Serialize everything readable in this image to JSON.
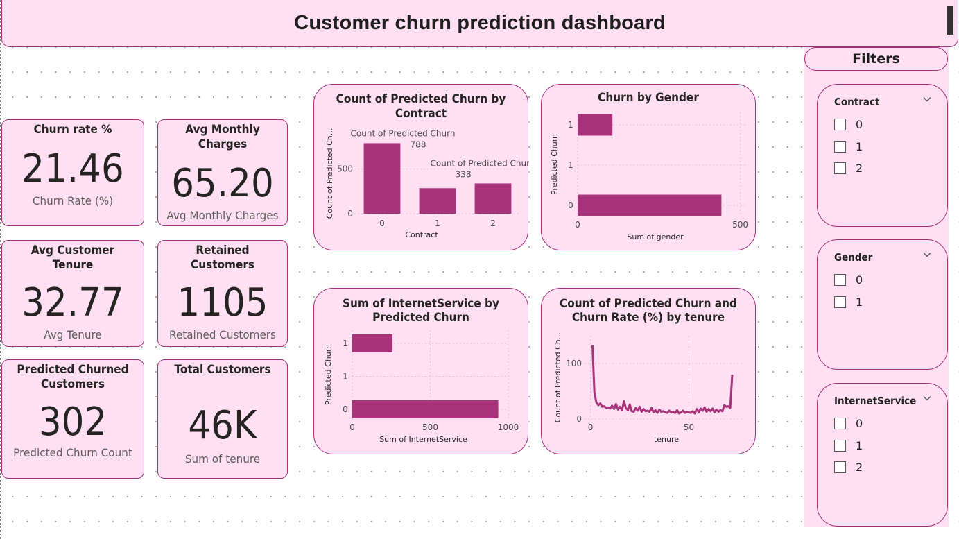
{
  "header": {
    "title": "Customer churn prediction dashboard"
  },
  "kpis": {
    "churn_rate": {
      "title": "Churn rate %",
      "value": "21.46",
      "subtitle": "Churn Rate (%)"
    },
    "avg_monthly": {
      "title": "Avg Monthly Charges",
      "value": "65.20",
      "subtitle": "Avg Monthly Charges"
    },
    "avg_tenure": {
      "title": "Avg Customer Tenure",
      "value": "32.77",
      "subtitle": "Avg Tenure"
    },
    "retained": {
      "title": "Retained Customers",
      "value": "1105",
      "subtitle": "Retained Customers"
    },
    "predicted_churned": {
      "title_line1": "Predicted Churned",
      "title_line2": "Customers",
      "value": "302",
      "subtitle": "Predicted Churn Count"
    },
    "total": {
      "title": "Total Customers",
      "value": "46K",
      "subtitle": "Sum of tenure"
    }
  },
  "chart_titles": {
    "contract": [
      "Count of Predicted Churn by",
      "Contract"
    ],
    "gender": [
      "Churn by Gender"
    ],
    "internet": [
      "Sum of InternetService by",
      "Predicted Churn"
    ],
    "tenure": [
      "Count of Predicted Churn and",
      "Churn Rate (%) by tenure"
    ]
  },
  "chart_data": [
    {
      "id": "contract",
      "type": "bar",
      "xlabel": "Contract",
      "ylabel": "Count of Predicted Ch...",
      "categories": [
        "0",
        "1",
        "2"
      ],
      "values": [
        788,
        285,
        338
      ],
      "ylim": [
        0,
        900
      ],
      "yticks": [
        0,
        500
      ],
      "data_labels": [
        {
          "index": 0,
          "name": "Count of Predicted Churn",
          "value": "788"
        },
        {
          "index": 2,
          "name": "Count of Predicted Churn",
          "value": "338"
        }
      ],
      "color": "#a8337a",
      "grid": true
    },
    {
      "id": "gender",
      "type": "bar",
      "orientation": "horizontal",
      "xlabel": "Sum of gender",
      "ylabel": "Predicted Churn",
      "categories": [
        "1",
        "0"
      ],
      "values": [
        107,
        442
      ],
      "xlim": [
        0,
        520
      ],
      "xticks": [
        0,
        500
      ],
      "yticks": [
        "1",
        "1",
        "0"
      ],
      "color": "#a8337a",
      "grid": true
    },
    {
      "id": "internet",
      "type": "bar",
      "orientation": "horizontal",
      "xlabel": "Sum of InternetService",
      "ylabel": "Predicted Churn",
      "categories": [
        "1",
        "0"
      ],
      "values": [
        258,
        936
      ],
      "xlim": [
        0,
        1000
      ],
      "xticks": [
        0,
        500,
        1000
      ],
      "yticks": [
        "1",
        "1",
        "0"
      ],
      "color": "#a8337a",
      "grid": true
    },
    {
      "id": "tenure",
      "type": "line",
      "xlabel": "tenure",
      "ylabel": "Count of Predicted Ch...",
      "xlim": [
        -3,
        78
      ],
      "ylim": [
        -5,
        150
      ],
      "xticks": [
        0,
        50
      ],
      "yticks": [
        0,
        100
      ],
      "x": [
        1,
        2,
        3,
        4,
        5,
        6,
        7,
        8,
        9,
        10,
        11,
        12,
        13,
        14,
        15,
        16,
        17,
        18,
        19,
        20,
        21,
        22,
        23,
        24,
        25,
        26,
        27,
        28,
        29,
        30,
        31,
        32,
        33,
        34,
        35,
        36,
        37,
        38,
        39,
        40,
        41,
        42,
        43,
        44,
        45,
        46,
        47,
        48,
        49,
        50,
        51,
        52,
        53,
        54,
        55,
        56,
        57,
        58,
        59,
        60,
        61,
        62,
        63,
        64,
        65,
        66,
        67,
        68,
        69,
        70,
        71,
        72
      ],
      "y": [
        133,
        48,
        30,
        25,
        28,
        22,
        23,
        20,
        21,
        19,
        24,
        18,
        27,
        17,
        22,
        16,
        32,
        20,
        16,
        26,
        14,
        13,
        20,
        15,
        22,
        13,
        18,
        14,
        15,
        13,
        20,
        12,
        16,
        11,
        17,
        13,
        14,
        12,
        11,
        15,
        12,
        13,
        11,
        16,
        10,
        12,
        15,
        11,
        13,
        12,
        11,
        14,
        10,
        18,
        12,
        19,
        15,
        21,
        13,
        18,
        14,
        19,
        12,
        17,
        13,
        16,
        14,
        25,
        22,
        23,
        20,
        80
      ],
      "color": "#a8337a",
      "grid": true
    }
  ],
  "filters": {
    "heading": "Filters",
    "slicers": [
      {
        "title": "Contract",
        "items": [
          "0",
          "1",
          "2"
        ]
      },
      {
        "title": "Gender",
        "items": [
          "0",
          "1"
        ]
      },
      {
        "title": "InternetService",
        "items": [
          "0",
          "1",
          "2"
        ]
      }
    ]
  },
  "colors": {
    "accent": "#a8337a",
    "card_bg": "#ffe0f3",
    "border": "#a0307a"
  },
  "icons": {
    "slicer_dropdown": "chevron-down-icon"
  }
}
